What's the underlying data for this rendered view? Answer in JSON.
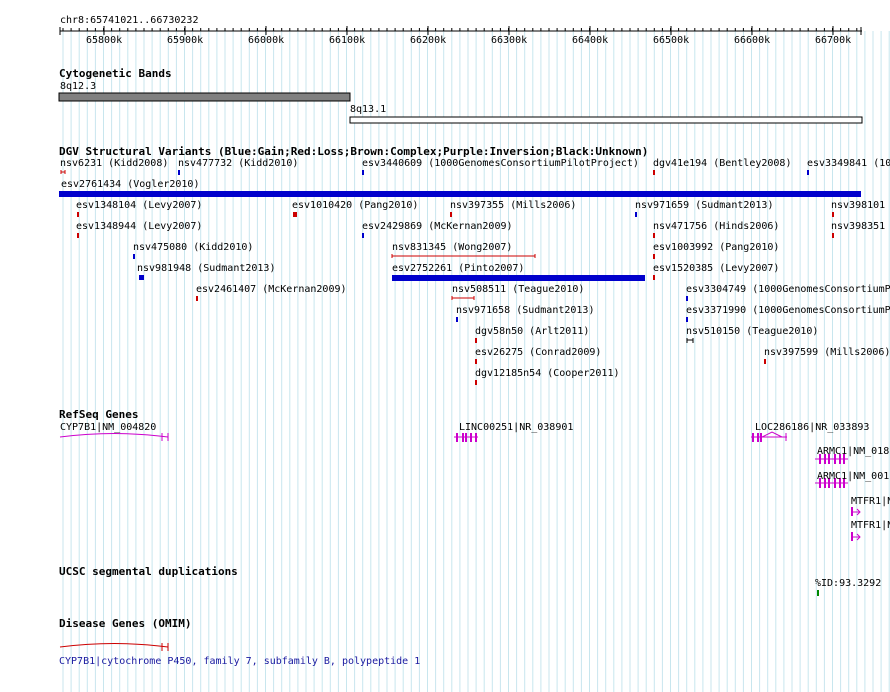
{
  "ruler": {
    "coordinate": "chr8:65741021..66730232",
    "ticks": [
      "65800k",
      "65900k",
      "66000k",
      "66100k",
      "66200k",
      "66300k",
      "66400k",
      "66500k",
      "66600k",
      "66700k"
    ]
  },
  "tracks": {
    "cytoband": {
      "title": "Cytogenetic Bands",
      "bands": [
        {
          "name": "8q12.3",
          "color": "#808080"
        },
        {
          "name": "8q13.1",
          "color": "#ffffff"
        }
      ]
    },
    "dgv": {
      "title": "DGV Structural Variants (Blue:Gain;Red:Loss;Brown:Complex;Purple:Inversion;Black:Unknown)",
      "colors": {
        "gain": "#0000cc",
        "loss": "#cc0000",
        "unknown": "#000000"
      },
      "features": [
        {
          "label": "nsv6231 (Kidd2008)",
          "type": "loss"
        },
        {
          "label": "nsv477732 (Kidd2010)",
          "type": "gain"
        },
        {
          "label": "esv3440609 (1000GenomesConsortiumPilotProject)",
          "type": "gain"
        },
        {
          "label": "dgv41e194 (Bentley2008)",
          "type": "loss"
        },
        {
          "label": "esv3349841 (10",
          "type": "gain"
        },
        {
          "label": "esv2761434 (Vogler2010)",
          "type": "gain"
        },
        {
          "label": "esv1348104 (Levy2007)",
          "type": "loss"
        },
        {
          "label": "esv1010420 (Pang2010)",
          "type": "loss"
        },
        {
          "label": "nsv397355 (Mills2006)",
          "type": "loss"
        },
        {
          "label": "nsv971659 (Sudmant2013)",
          "type": "gain"
        },
        {
          "label": "nsv398101",
          "type": "loss"
        },
        {
          "label": "esv1348944 (Levy2007)",
          "type": "loss"
        },
        {
          "label": "esv2429869 (McKernan2009)",
          "type": "gain"
        },
        {
          "label": "nsv471756 (Hinds2006)",
          "type": "loss"
        },
        {
          "label": "nsv398351",
          "type": "loss"
        },
        {
          "label": "nsv475080 (Kidd2010)",
          "type": "gain"
        },
        {
          "label": "nsv831345 (Wong2007)",
          "type": "loss"
        },
        {
          "label": "esv1003992 (Pang2010)",
          "type": "loss"
        },
        {
          "label": "nsv981948 (Sudmant2013)",
          "type": "gain"
        },
        {
          "label": "esv2752261 (Pinto2007)",
          "type": "gain"
        },
        {
          "label": "esv1520385 (Levy2007)",
          "type": "loss"
        },
        {
          "label": "esv2461407 (McKernan2009)",
          "type": "loss"
        },
        {
          "label": "nsv508511 (Teague2010)",
          "type": "loss"
        },
        {
          "label": "esv3304749 (1000GenomesConsortiumP",
          "type": "gain"
        },
        {
          "label": "nsv971658 (Sudmant2013)",
          "type": "gain"
        },
        {
          "label": "esv3371990 (1000GenomesConsortiumP",
          "type": "gain"
        },
        {
          "label": "dgv58n50 (Arlt2011)",
          "type": "loss"
        },
        {
          "label": "nsv510150 (Teague2010)",
          "type": "unknown"
        },
        {
          "label": "esv26275 (Conrad2009)",
          "type": "loss"
        },
        {
          "label": "nsv397599 (Mills2006)",
          "type": "loss"
        },
        {
          "label": "dgv12185n54 (Cooper2011)",
          "type": "loss"
        }
      ]
    },
    "refseq": {
      "title": "RefSeq Genes",
      "color": "#cc00cc",
      "genes": [
        {
          "label": "CYP7B1|NM_004820"
        },
        {
          "label": "LINC00251|NR_038901"
        },
        {
          "label": "LOC286186|NR_033893"
        },
        {
          "label": "ARMC1|NM_018"
        },
        {
          "label": "ARMC1|NM_001"
        },
        {
          "label": "MTFR1|N"
        },
        {
          "label": "MTFR1|N"
        }
      ]
    },
    "segdup": {
      "title": "UCSC segmental duplications",
      "label": "%ID:93.3292",
      "color": "#008800"
    },
    "omim": {
      "title": "Disease Genes (OMIM)",
      "color": "#cc0000",
      "description": "CYP7B1|cytochrome P450, family 7, subfamily B, polypeptide 1"
    }
  }
}
